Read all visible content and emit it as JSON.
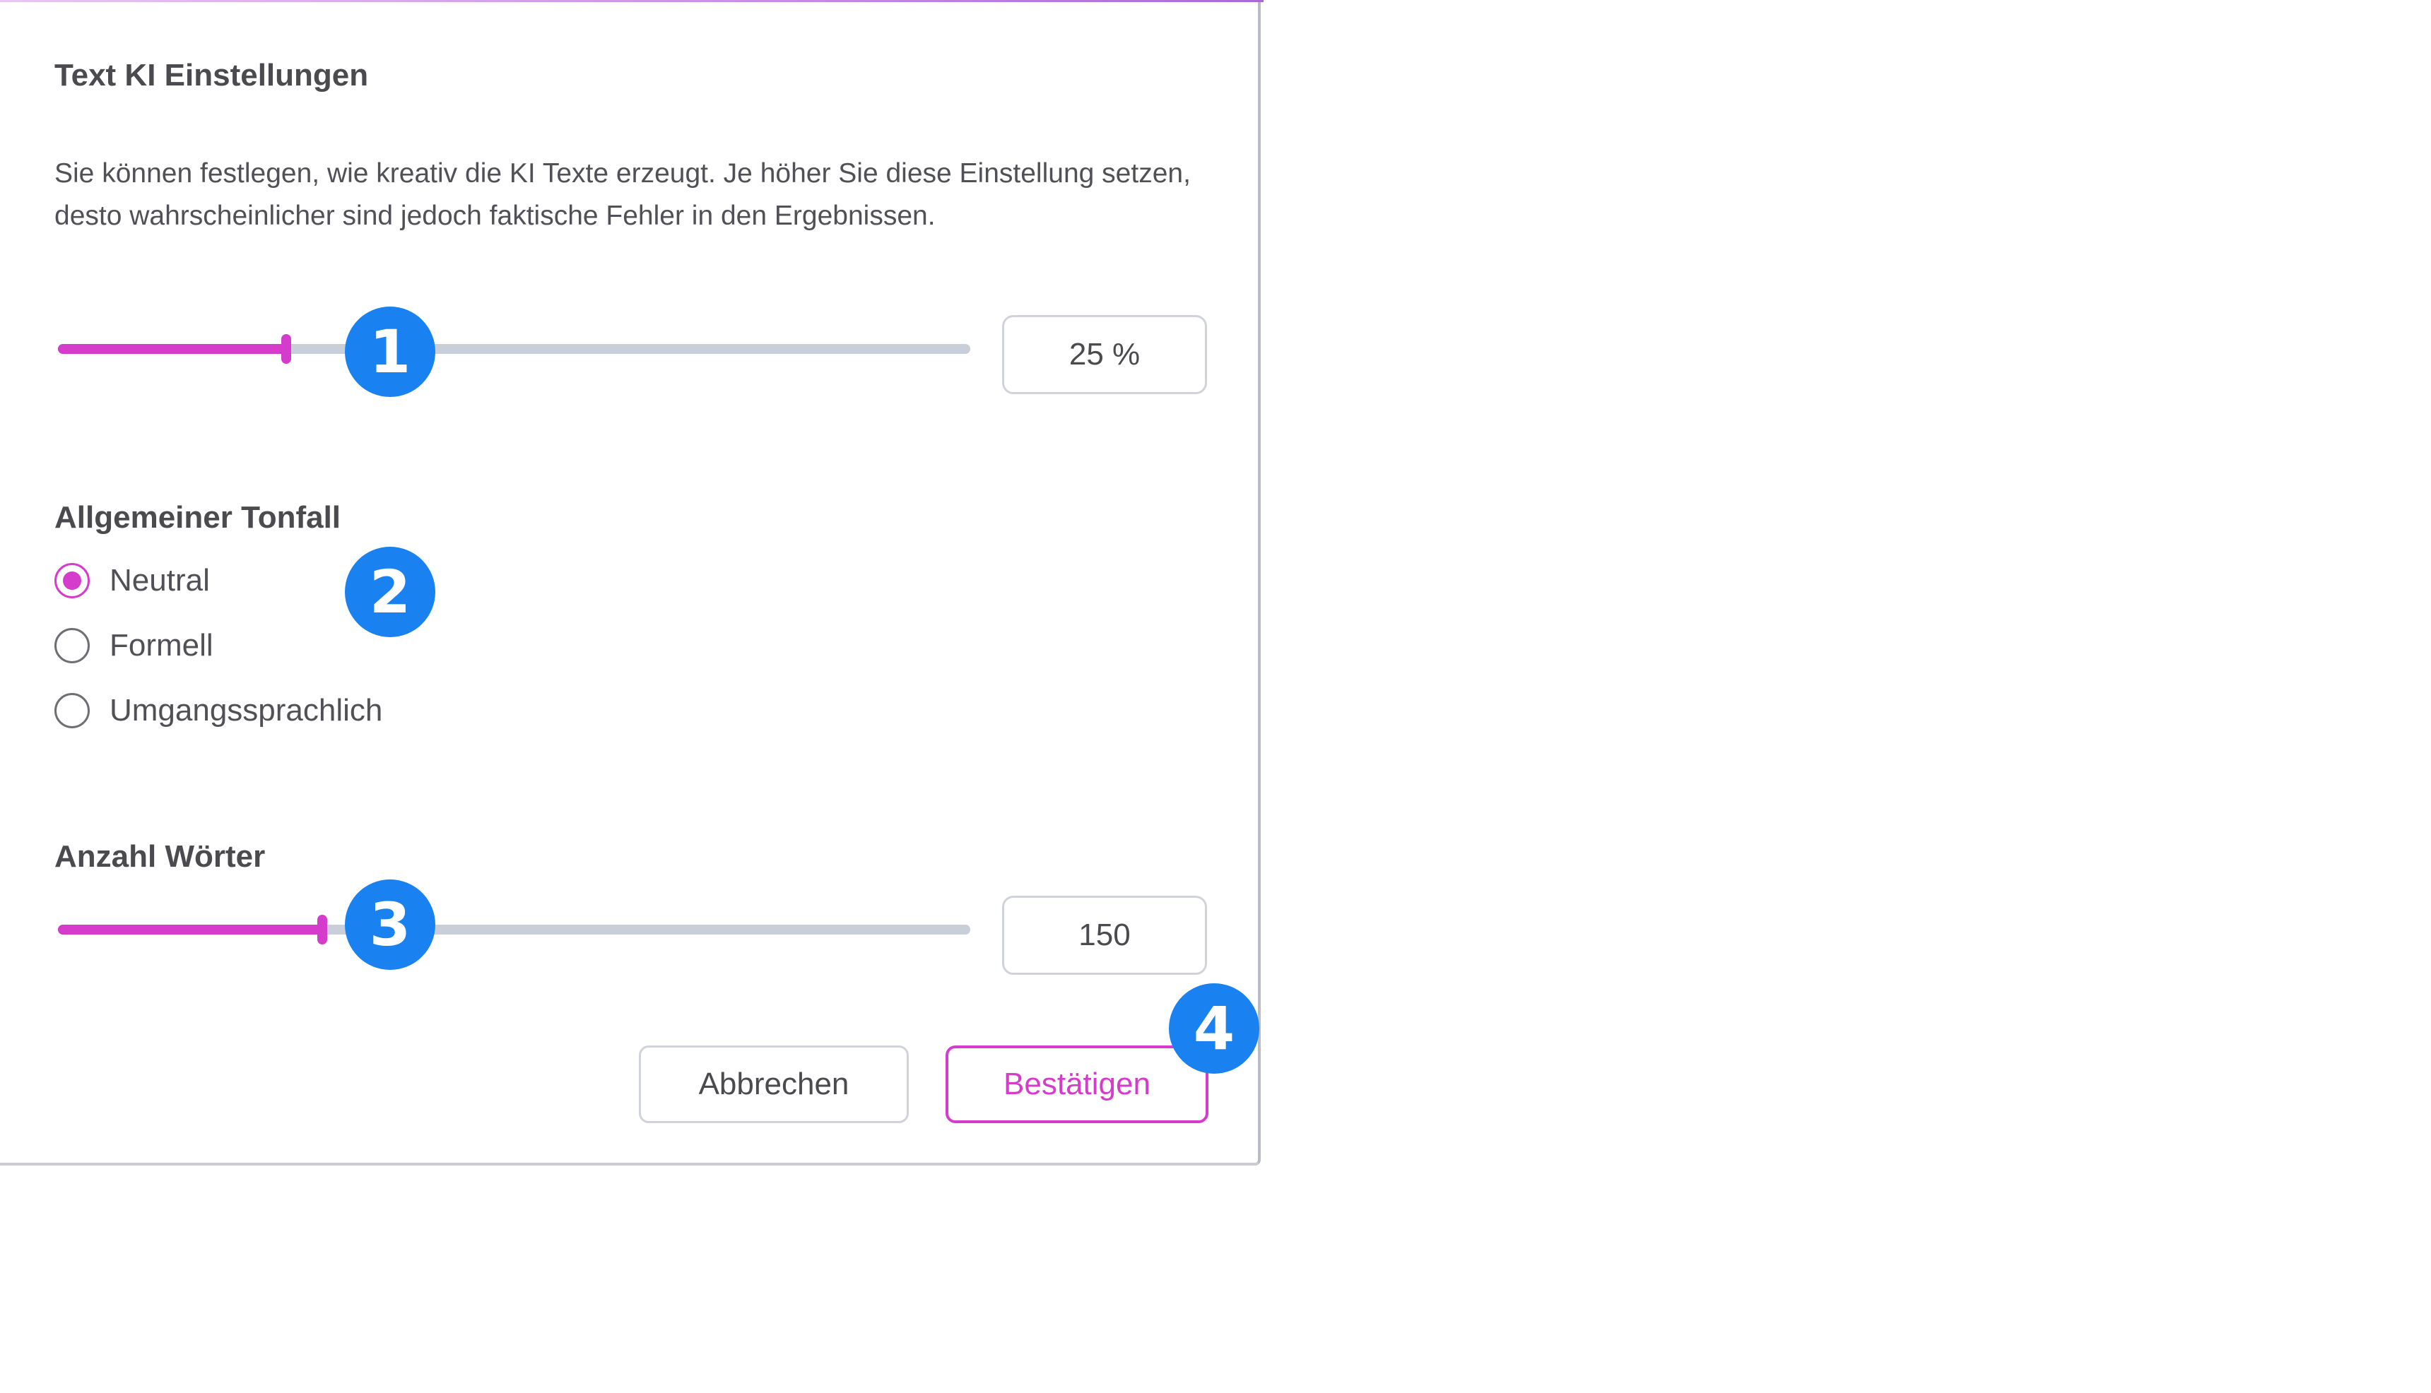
{
  "dialog": {
    "title": "Text KI Einstellungen",
    "description": "Sie können festlegen, wie kreativ die KI Texte erzeugt. Je höher Sie diese Einstellung setzen, desto wahrscheinlicher sind jedoch faktische Fehler in den Ergebnissen."
  },
  "creativity": {
    "value_text": "25 %",
    "level": 0.25
  },
  "tone": {
    "label": "Allgemeiner Tonfall",
    "options": [
      {
        "label": "Neutral",
        "selected": true
      },
      {
        "label": "Formell",
        "selected": false
      },
      {
        "label": "Umgangssprachlich",
        "selected": false
      }
    ]
  },
  "words": {
    "label": "Anzahl Wörter",
    "value_text": "150",
    "level": 0.29
  },
  "buttons": {
    "cancel": "Abbrechen",
    "confirm": "Bestätigen"
  },
  "markers": [
    "1",
    "2",
    "3",
    "4"
  ],
  "colors": {
    "accent": "#d63ccb",
    "marker": "#1a82f0",
    "track": "#c9cfd9"
  }
}
